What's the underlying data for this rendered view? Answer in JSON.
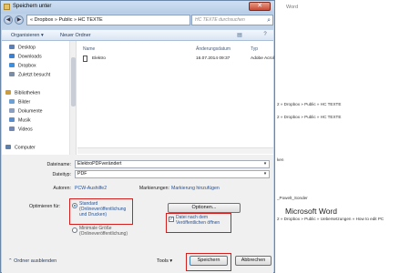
{
  "background": {
    "title": "Word",
    "lines": [
      "2 » Dropbox » Public » HC TEXTE",
      "2 » Dropbox » Public » HC TEXTE",
      "ken",
      "_Powelt_Sonder",
      "2 » Dropbox » Public » Uebersetzungen » How to edit PC"
    ],
    "heading": "Microsoft Word"
  },
  "dialog": {
    "title": "Speichern unter",
    "close_symbol": "✕",
    "path": "« Dropbox » Public » HC TEXTE",
    "search_placeholder": "HC TEXTE durchsuchen",
    "toolbar": {
      "organize": "Organisieren ▾",
      "new_folder": "Neuer Ordner"
    },
    "nav_items": [
      {
        "label": "Desktop",
        "color": "#5a7fb4"
      },
      {
        "label": "Downloads",
        "color": "#3f7fd0"
      },
      {
        "label": "Dropbox",
        "color": "#3e8ee0"
      },
      {
        "label": "Zuletzt besucht",
        "color": "#7b8da6"
      },
      {
        "label": "Bibliotheken",
        "color": "#c99d3f"
      },
      {
        "label": "Bilder",
        "color": "#6aa0d6"
      },
      {
        "label": "Dokumente",
        "color": "#8ba0c0"
      },
      {
        "label": "Musik",
        "color": "#5b8ccb"
      },
      {
        "label": "Videos",
        "color": "#7287b2"
      },
      {
        "label": "Computer",
        "color": "#5e7fa8"
      }
    ],
    "columns": {
      "name": "Name",
      "date": "Änderungsdatum",
      "type": "Typ"
    },
    "files": [
      {
        "name": "Elektro",
        "date": "16.07.2014 09:37",
        "type": "Adobe Acrol"
      }
    ],
    "form": {
      "filename_label": "Dateiname:",
      "filename_value": "ElektroPDFverändert",
      "filetype_label": "Dateityp:",
      "filetype_value": "PDF",
      "authors_label": "Autoren:",
      "authors_value": "PCW-Aushilfe2",
      "tags_label": "Markierungen:",
      "tags_value": "Markierung hinzufügen",
      "optimize_label": "Optimieren für:",
      "opt_standard": "Standard (Onlineveröffentlichung und Drucken)",
      "opt_minimal": "Minimale Größe (Onlineveröffentlichung)",
      "options_button": "Optionen...",
      "open_after_publish": "Datei nach dem Veröffentlichen öffnen",
      "hide_folders": "Ordner ausblenden",
      "tools": "Tools",
      "save_button": "Speichern",
      "cancel_button": "Abbrechen"
    }
  }
}
